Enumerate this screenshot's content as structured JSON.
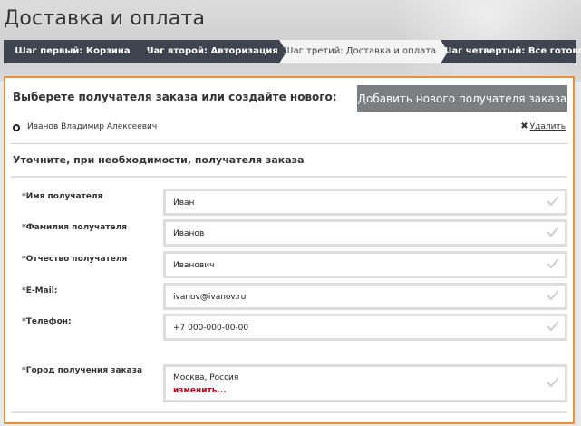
{
  "header": {
    "title": "Доставка и оплата"
  },
  "steps": [
    {
      "label": "Шаг первый: Корзина",
      "active": false
    },
    {
      "label": "Шаг второй: Авторизация",
      "active": false
    },
    {
      "label": "Шаг третий: Доставка и оплата",
      "active": true
    },
    {
      "label": "Шаг четвертый: Все готово!",
      "active": false
    }
  ],
  "recipient": {
    "choose_text": "Выберете получателя заказа или создайте нового:",
    "add_button": "Добавить нового получателя заказа",
    "name": "Иванов Владимир Алексеевич",
    "delete_label": "Удалить"
  },
  "form": {
    "heading": "Уточните, при необходимости, получателя заказа",
    "fields": [
      {
        "label": "*Имя получателя",
        "value": "Иван"
      },
      {
        "label": "*Фамилия получателя",
        "value": "Иванов"
      },
      {
        "label": "*Отчество получателя",
        "value": "Иванович"
      },
      {
        "label": "*E-Mail:",
        "value": "ivanov@ivanov.ru"
      },
      {
        "label": "*Телефон:",
        "value": "+7 000-000-00-00"
      }
    ],
    "city": {
      "label": "*Город получения заказа",
      "value": "Москва, Россия",
      "change": "изменить..."
    }
  },
  "colors": {
    "accent": "#e8903a",
    "steps_bg": "#3f4550",
    "change_link": "#a3141e"
  }
}
